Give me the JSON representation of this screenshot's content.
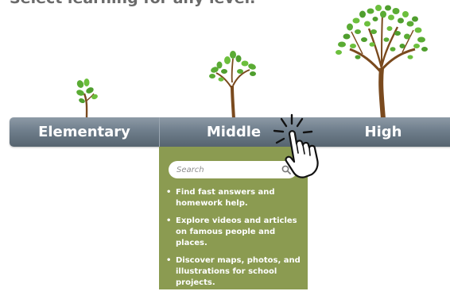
{
  "headline": "Select learning for any level.",
  "levels": {
    "elementary": "Elementary",
    "middle": "Middle",
    "high": "High"
  },
  "middle_panel": {
    "search_placeholder": "Search",
    "bullets": [
      "Find fast answers and homework help.",
      "Explore videos and articles on famous people and places.",
      "Discover maps, photos, and illustrations for school projects."
    ]
  },
  "icons": {
    "search": "search-icon",
    "pointer": "hand-pointer-icon",
    "sprout": "sprout-icon",
    "young_tree": "young-tree-icon",
    "tree": "tree-icon"
  },
  "colors": {
    "bar": "#6f7e8c",
    "panel": "#8b9b51",
    "leaf": "#5aab34",
    "trunk": "#7a4a1e",
    "headline": "#6a6a6a"
  }
}
